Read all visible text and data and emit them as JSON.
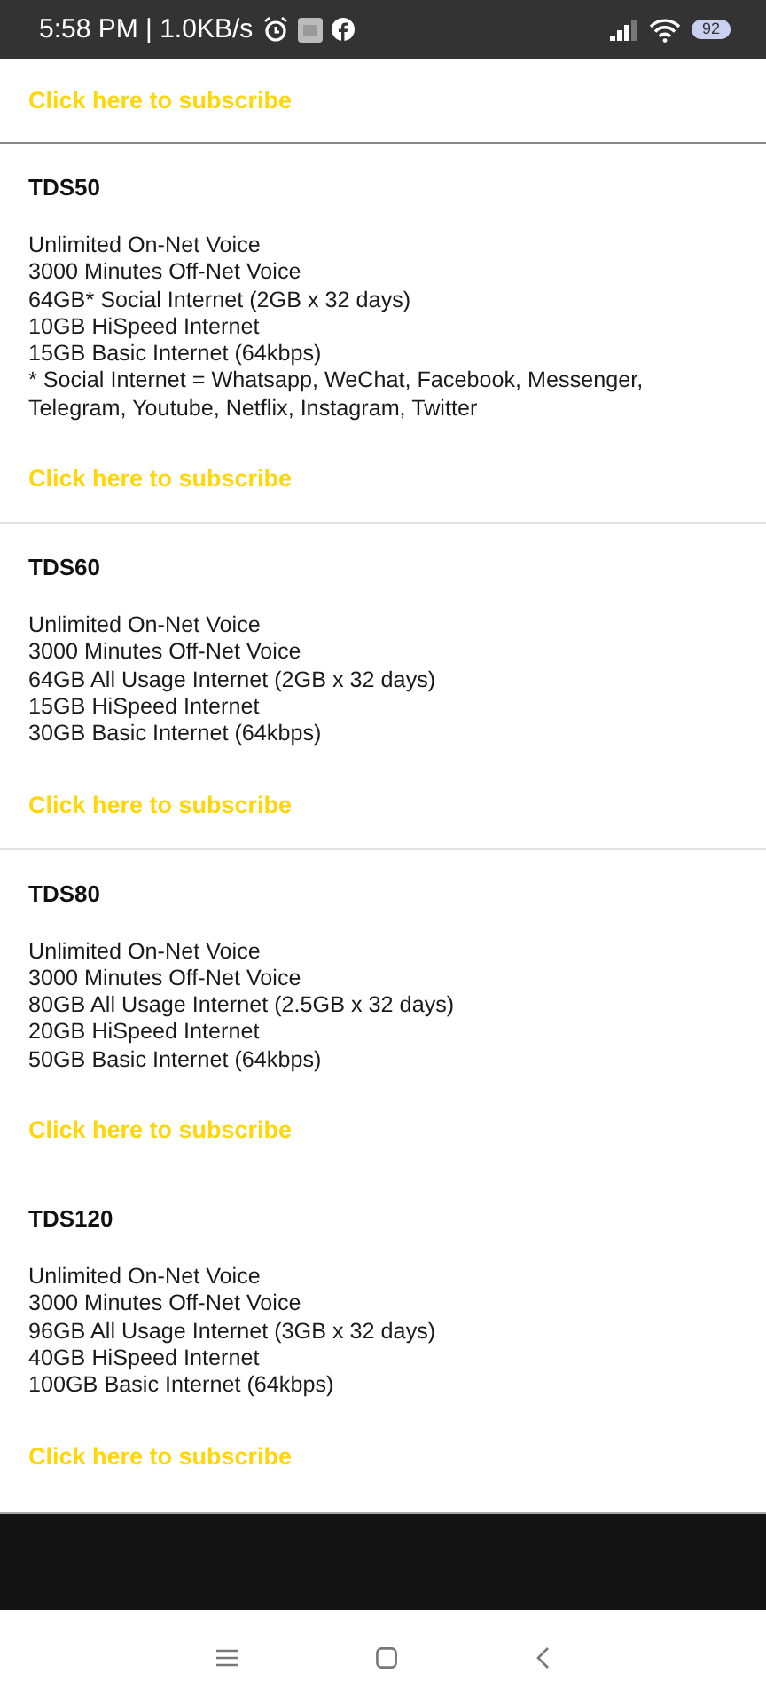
{
  "status_bar": {
    "time": "5:58 PM | 1.0KB/s",
    "battery": "92"
  },
  "top_link": {
    "label": "Click here to subscribe",
    "divider_after": true
  },
  "plans": [
    {
      "name": "TDS50",
      "lines": [
        "Unlimited On-Net Voice",
        "3000 Minutes Off-Net Voice",
        "64GB* Social Internet (2GB x 32 days)",
        "10GB HiSpeed Internet",
        "15GB Basic Internet (64kbps)",
        "* Social Internet = Whatsapp, WeChat, Facebook, Messenger, Telegram, Youtube, Netflix, Instagram, Twitter"
      ],
      "link": "Click here to subscribe",
      "divider_after": true
    },
    {
      "name": "TDS60",
      "lines": [
        "Unlimited On-Net Voice",
        "3000 Minutes Off-Net Voice",
        "64GB All Usage Internet (2GB x 32 days)",
        "15GB HiSpeed Internet",
        "30GB Basic Internet (64kbps)"
      ],
      "link": "Click here to subscribe",
      "divider_after": true
    },
    {
      "name": "TDS80",
      "lines": [
        "Unlimited On-Net Voice",
        "3000 Minutes Off-Net Voice",
        "80GB All Usage Internet (2.5GB x 32 days)",
        "20GB HiSpeed Internet",
        "50GB Basic Internet (64kbps)"
      ],
      "link": "Click here to subscribe",
      "divider_after": false
    },
    {
      "name": "TDS120",
      "lines": [
        "Unlimited On-Net Voice",
        "3000 Minutes Off-Net Voice",
        "96GB All Usage Internet (3GB x 32 days)",
        "40GB HiSpeed Internet",
        "100GB Basic Internet (64kbps)"
      ],
      "link": "Click here to subscribe",
      "divider_after": false
    }
  ]
}
